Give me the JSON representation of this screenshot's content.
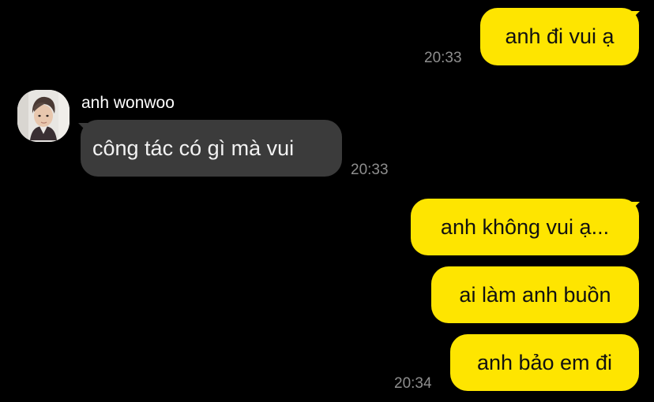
{
  "colors": {
    "background": "#000000",
    "outgoing_bubble": "#FEE500",
    "incoming_bubble": "#3B3B3B",
    "timestamp": "#8E8E8E"
  },
  "messages": [
    {
      "direction": "outgoing",
      "text": "anh đi vui ạ",
      "time": "20:33"
    },
    {
      "direction": "incoming",
      "sender": "anh wonwoo",
      "avatar_icon": "profile-photo",
      "text": "công tác có gì mà vui",
      "time": "20:33"
    },
    {
      "direction": "outgoing",
      "text": "anh không vui ạ..."
    },
    {
      "direction": "outgoing",
      "text": "ai làm anh buồn"
    },
    {
      "direction": "outgoing",
      "text": "anh bảo em đi",
      "time": "20:34"
    }
  ]
}
